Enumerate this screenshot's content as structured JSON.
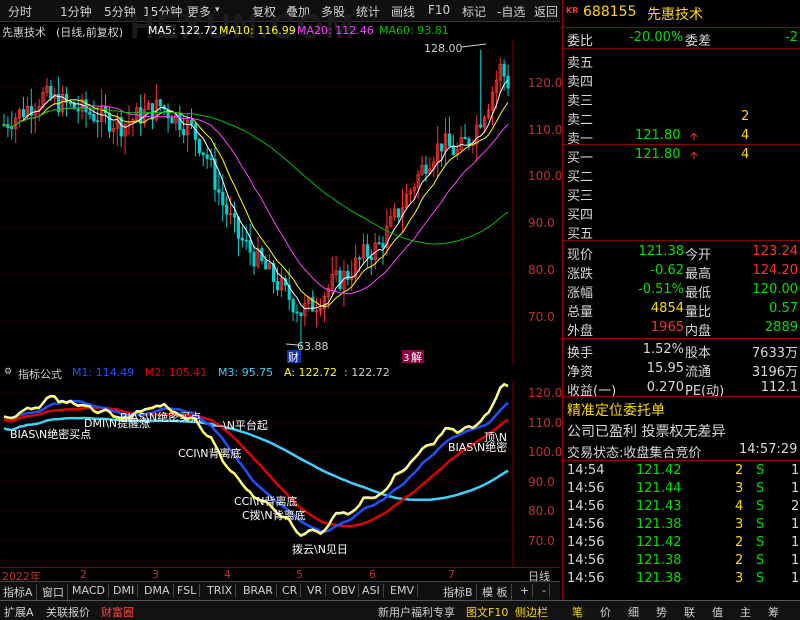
{
  "toolbar": {
    "items": [
      "分时",
      "1分钟",
      "5分钟",
      "15分钟",
      "更多",
      "复权",
      "叠加",
      "多股",
      "统计",
      "画线",
      "F10",
      "标记",
      "-自选",
      "返回"
    ],
    "more_caret": "▾",
    "watermark": "HEXUN.COM"
  },
  "ma_bar": {
    "stock_label": "先惠技术",
    "cycle_label": "(日线,前复权)",
    "ma5": "MA5: 122.72",
    "ma10": "MA10: 116.99",
    "ma20": "MA20: 112.46",
    "ma60": "MA60: 93.81"
  },
  "main_chart": {
    "y_ticks": [
      "120.0",
      "110.0",
      "100.0",
      "90.0",
      "80.0",
      "70.0"
    ],
    "high_label": "128.00",
    "low_label": "63.88",
    "badge_cai": "财",
    "badge_jie": "解",
    "badge_jie_num": "3"
  },
  "sub_chart": {
    "title": "指标公式",
    "m1": "M1: 114.49",
    "m2": "M2: 105.41",
    "m3": "M3: 95.75",
    "a": "A: 122.72",
    "a2": ": 122.72",
    "y_ticks": [
      "120.0",
      "110.0",
      "100.0",
      "90.0",
      "80.0",
      "70.0"
    ],
    "annotations": [
      "BIAS\\N绝密买点",
      "DMI\\N提醒涨",
      "BIAS\\N绝密买点",
      "—\\N平台起",
      "CCI\\N背离底",
      "CCI\\N背离底",
      "C拨\\N背离底",
      "拨云\\N见日",
      "BIAS\\N绝密",
      "顶\\N"
    ]
  },
  "date_axis": {
    "labels": [
      "2022年",
      "2",
      "3",
      "4",
      "5",
      "6",
      "7"
    ],
    "period": "日线"
  },
  "indicator_tabs": [
    "指标A",
    "窗口",
    "MACD",
    "DMI",
    "DMA",
    "FSL",
    "TRIX",
    "BRAR",
    "CR",
    "VR",
    "OBV",
    "ASI",
    "EMV",
    "指标B",
    "模 板",
    "+",
    "-"
  ],
  "bottom_bar": {
    "left": [
      "扩展A",
      "关联报价",
      "财富圈"
    ],
    "right": [
      "新用户福利专享",
      "图文F10",
      "侧边栏"
    ],
    "icons": [
      "笔",
      "价",
      "细",
      "势",
      "联",
      "值",
      "主",
      "筹"
    ]
  },
  "quote": {
    "code": "688155",
    "name": "先惠技术",
    "kr": "KR",
    "weibi_label": "委比",
    "weibi_value": "-20.00%",
    "weicha_label": "委差",
    "weicha_value": "-2",
    "asks": [
      {
        "label": "卖五",
        "price": "",
        "vol": ""
      },
      {
        "label": "卖四",
        "price": "",
        "vol": ""
      },
      {
        "label": "卖三",
        "price": "",
        "vol": ""
      },
      {
        "label": "卖二",
        "price": "",
        "vol": "2"
      },
      {
        "label": "卖一",
        "price": "121.80",
        "vol": "4"
      }
    ],
    "bids": [
      {
        "label": "买一",
        "price": "121.80",
        "vol": "4"
      },
      {
        "label": "买二",
        "price": "",
        "vol": ""
      },
      {
        "label": "买三",
        "price": "",
        "vol": ""
      },
      {
        "label": "买四",
        "price": "",
        "vol": ""
      },
      {
        "label": "买五",
        "price": "",
        "vol": ""
      }
    ],
    "stats": [
      {
        "l1": "现价",
        "v1": "121.38",
        "c1": "g",
        "l2": "今开",
        "v2": "123.24",
        "c2": "r"
      },
      {
        "l1": "涨跌",
        "v1": "-0.62",
        "c1": "g",
        "l2": "最高",
        "v2": "124.20",
        "c2": "r"
      },
      {
        "l1": "涨幅",
        "v1": "-0.51%",
        "c1": "g",
        "l2": "最低",
        "v2": "120.00",
        "c2": "g"
      },
      {
        "l1": "总量",
        "v1": "4854",
        "c1": "y",
        "l2": "量比",
        "v2": "0.57",
        "c2": "g"
      },
      {
        "l1": "外盘",
        "v1": "1965",
        "c1": "r",
        "l2": "内盘",
        "v2": "2889",
        "c2": "g"
      }
    ],
    "stats2": [
      {
        "l1": "换手",
        "v1": "1.52%",
        "l2": "股本",
        "v2": "7633万"
      },
      {
        "l1": "净资",
        "v1": "15.95",
        "l2": "流通",
        "v2": "3196万"
      },
      {
        "l1": "收益(一)",
        "v1": "0.270",
        "l2": "PE(动)",
        "v2": "112.1"
      }
    ],
    "promo1": "精准定位委托单",
    "promo2": "公司已盈利 投票权无差异",
    "trade_state": "交易状态:收盘集合竞价",
    "trade_time": "14:57:29",
    "ticks": [
      {
        "t": "14:54",
        "p": "121.42",
        "v": "2",
        "s": "S",
        "n": "1"
      },
      {
        "t": "14:56",
        "p": "121.44",
        "v": "3",
        "s": "S",
        "n": "1"
      },
      {
        "t": "14:56",
        "p": "121.43",
        "v": "4",
        "s": "S",
        "n": "2"
      },
      {
        "t": "14:56",
        "p": "121.38",
        "v": "3",
        "s": "S",
        "n": "1"
      },
      {
        "t": "14:56",
        "p": "121.42",
        "v": "2",
        "s": "S",
        "n": "1"
      },
      {
        "t": "14:56",
        "p": "121.38",
        "v": "2",
        "s": "S",
        "n": "1"
      },
      {
        "t": "14:56",
        "p": "121.38",
        "v": "3",
        "s": "S",
        "n": "1"
      }
    ]
  },
  "colors": {
    "up": "#ff3030",
    "down": "#00d0d0",
    "ma5": "#ffffff",
    "ma10": "#ffff00",
    "ma20": "#ff40ff",
    "ma60": "#00c000",
    "m1": "#2050ff",
    "m2": "#e00000",
    "m3": "#40d0ff",
    "a": "#ffff00"
  }
}
